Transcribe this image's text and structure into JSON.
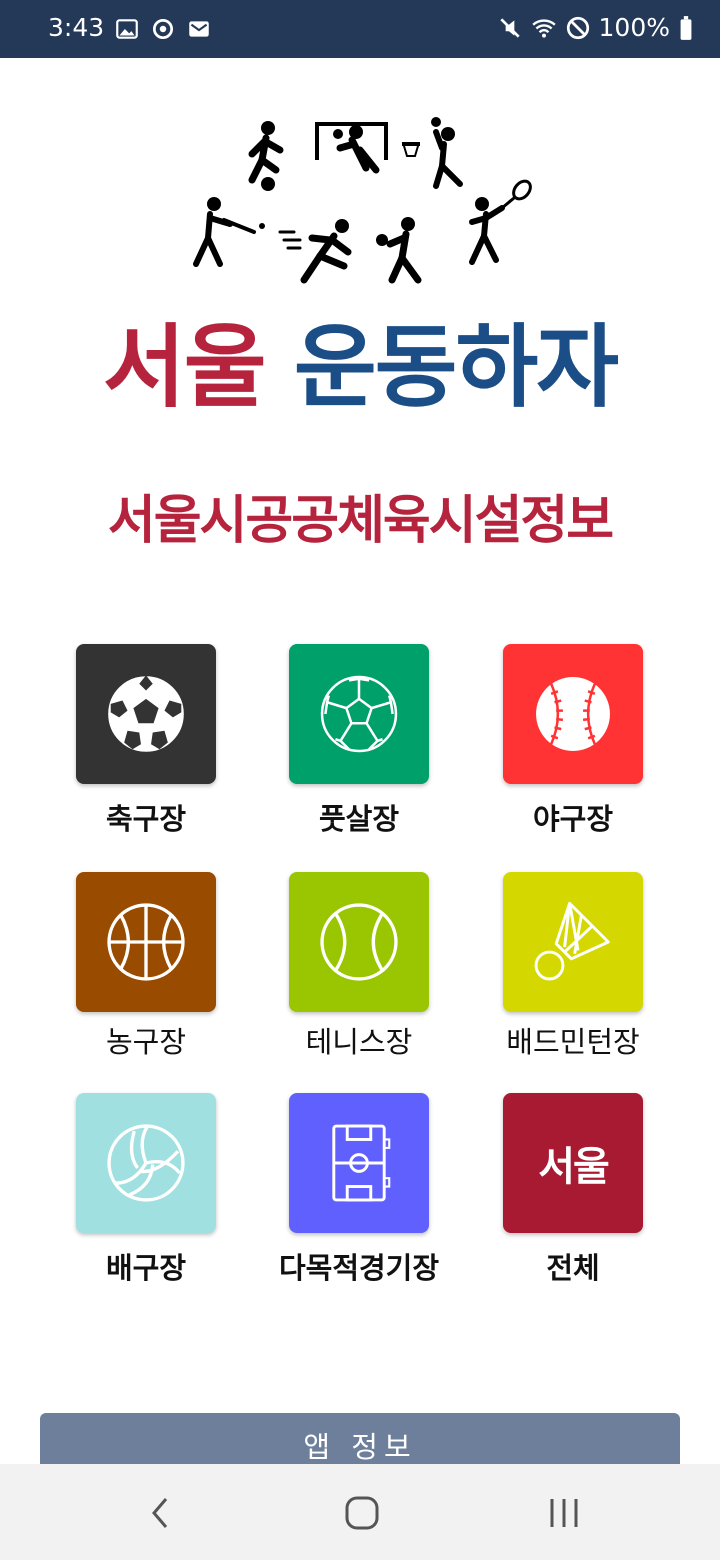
{
  "status_bar": {
    "time": "3:43",
    "battery": "100%",
    "left_icons": [
      "image-icon",
      "sync-icon",
      "gmail-icon"
    ],
    "right_icons": [
      "mute-icon",
      "wifi-icon",
      "do-not-disturb-icon",
      "battery-icon"
    ]
  },
  "hero": {
    "title_part1": "서울",
    "title_part2": "운동하자",
    "subtitle": "서울시공공체육시설정보",
    "colors": {
      "red": "#b5233d",
      "blue": "#1b4e87"
    }
  },
  "categories": [
    {
      "label": "축구장",
      "icon": "soccer-ball-icon",
      "color": "#333333"
    },
    {
      "label": "풋살장",
      "icon": "futsal-ball-icon",
      "color": "#00a06a"
    },
    {
      "label": "야구장",
      "icon": "baseball-icon",
      "color": "#ff3333"
    },
    {
      "label": "농구장",
      "icon": "basketball-icon",
      "color": "#994b00"
    },
    {
      "label": "테니스장",
      "icon": "tennis-ball-icon",
      "color": "#99c600"
    },
    {
      "label": "배드민턴장",
      "icon": "shuttlecock-icon",
      "color": "#d4d800"
    },
    {
      "label": "배구장",
      "icon": "volleyball-icon",
      "color": "#a0e0e0"
    },
    {
      "label": "다목적경기장",
      "icon": "field-icon",
      "color": "#6060ff"
    },
    {
      "label": "전체",
      "icon": "seoul-logo-icon",
      "color": "#a81a32",
      "logo_text": "서울"
    }
  ],
  "app_info_button": "앱 정보",
  "nav": [
    "back-icon",
    "home-icon",
    "recents-icon"
  ]
}
